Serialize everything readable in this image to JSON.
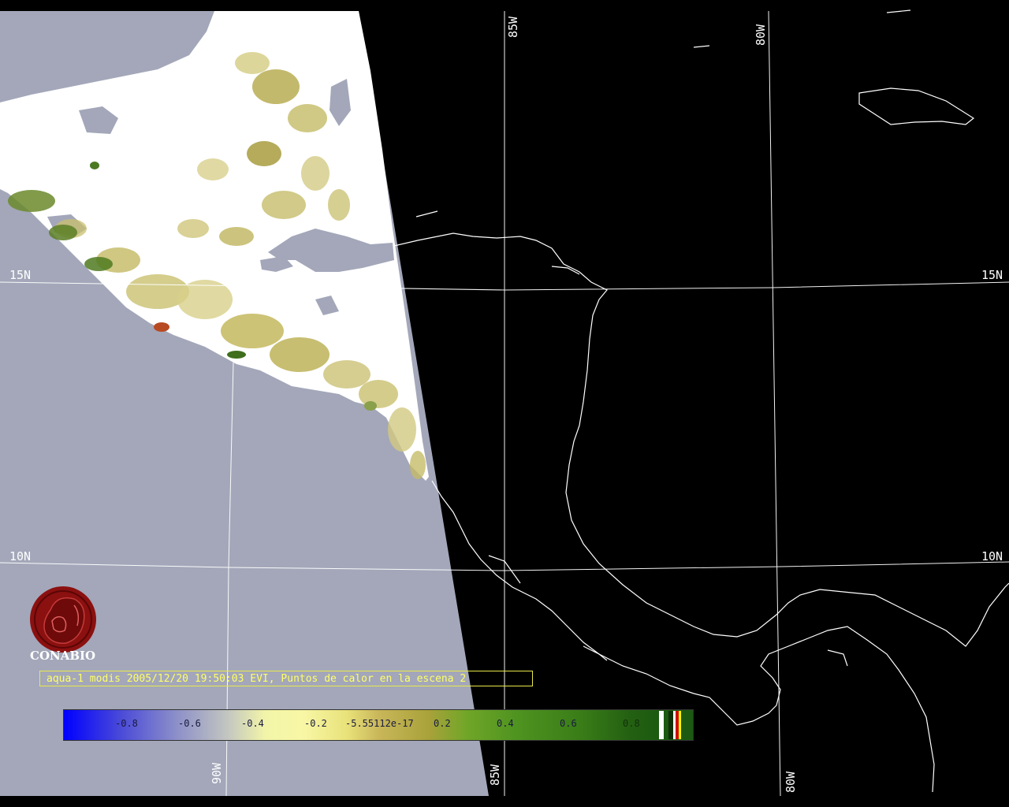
{
  "map": {
    "grid_labels": {
      "lat_15n_left": "15N",
      "lat_15n_right": "15N",
      "lat_10n_left": "10N",
      "lat_10n_right": "10N",
      "lon_85w_top": "85W",
      "lon_80w_top": "80W",
      "lon_90w_bottom": "90W",
      "lon_85w_bottom": "85W",
      "lon_80w_bottom": "80W"
    },
    "colors": {
      "ocean_in_swath": "#a3a7b9",
      "outside_swath": "#000000",
      "cloud": "#ffffff",
      "coastline": "#ffffff",
      "grid": "#ffffff"
    }
  },
  "logo": {
    "text": "CONABIO",
    "color": "#8b1010"
  },
  "caption": {
    "text": "aqua-1 modis 2005/12/20 19:50:03 EVI, Puntos de calor en la escena 2"
  },
  "colorbar": {
    "ticks": [
      "-0.8",
      "-0.6",
      "-0.4",
      "-0.2",
      "-5.55112e-17",
      "0.2",
      "0.4",
      "0.6",
      "0.8"
    ]
  }
}
